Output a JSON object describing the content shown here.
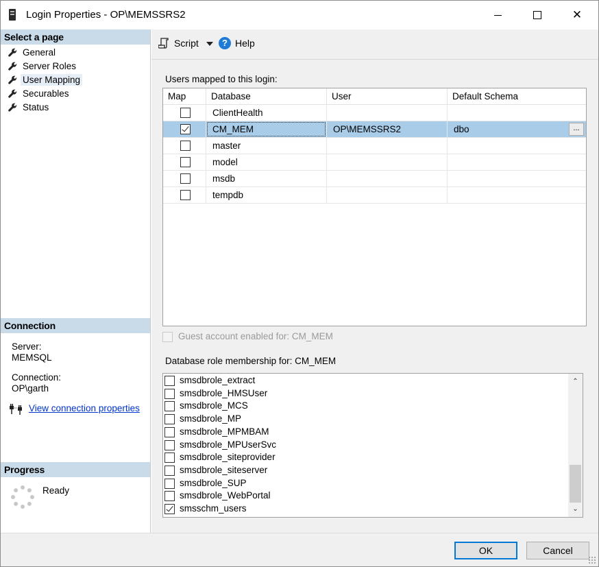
{
  "window": {
    "title": "Login Properties - OP\\MEMSSRS2",
    "minimize_glyph": "",
    "close_glyph": "✕"
  },
  "left_pane": {
    "select_page_header": "Select a page",
    "pages": [
      {
        "label": "General",
        "icon": "wrench-icon"
      },
      {
        "label": "Server Roles",
        "icon": "wrench-icon"
      },
      {
        "label": "User Mapping",
        "icon": "wrench-icon",
        "selected": true
      },
      {
        "label": "Securables",
        "icon": "wrench-icon"
      },
      {
        "label": "Status",
        "icon": "wrench-icon"
      }
    ],
    "connection_header": "Connection",
    "server_label": "Server:",
    "server_value": "MEMSQL",
    "connection_label": "Connection:",
    "connection_value": "OP\\garth",
    "view_connection_link": "View connection properties",
    "progress_header": "Progress",
    "progress_status": "Ready"
  },
  "toolbar": {
    "script_label": "Script",
    "help_label": "Help",
    "help_glyph": "?"
  },
  "main": {
    "users_mapped_label": "Users mapped to this login:",
    "grid": {
      "columns": [
        "Map",
        "Database",
        "User",
        "Default Schema"
      ],
      "rows": [
        {
          "map": false,
          "database": "ClientHealth",
          "user": "",
          "schema": ""
        },
        {
          "map": true,
          "database": "CM_MEM",
          "user": "OP\\MEMSSRS2",
          "schema": "dbo",
          "selected": true,
          "browse": "..."
        },
        {
          "map": false,
          "database": "master",
          "user": "",
          "schema": ""
        },
        {
          "map": false,
          "database": "model",
          "user": "",
          "schema": ""
        },
        {
          "map": false,
          "database": "msdb",
          "user": "",
          "schema": ""
        },
        {
          "map": false,
          "database": "tempdb",
          "user": "",
          "schema": ""
        }
      ]
    },
    "guest_label": "Guest account enabled for: CM_MEM",
    "guest_checked": false,
    "role_membership_label": "Database role membership for: CM_MEM",
    "roles": [
      {
        "label": "smsdbrole_extract",
        "checked": false
      },
      {
        "label": "smsdbrole_HMSUser",
        "checked": false
      },
      {
        "label": "smsdbrole_MCS",
        "checked": false
      },
      {
        "label": "smsdbrole_MP",
        "checked": false
      },
      {
        "label": "smsdbrole_MPMBAM",
        "checked": false
      },
      {
        "label": "smsdbrole_MPUserSvc",
        "checked": false
      },
      {
        "label": "smsdbrole_siteprovider",
        "checked": false
      },
      {
        "label": "smsdbrole_siteserver",
        "checked": false
      },
      {
        "label": "smsdbrole_SUP",
        "checked": false
      },
      {
        "label": "smsdbrole_WebPortal",
        "checked": false
      },
      {
        "label": "smsschm_users",
        "checked": true
      }
    ],
    "scroll_up_glyph": "⌃",
    "scroll_down_glyph": "⌄"
  },
  "footer": {
    "ok_label": "OK",
    "cancel_label": "Cancel"
  }
}
